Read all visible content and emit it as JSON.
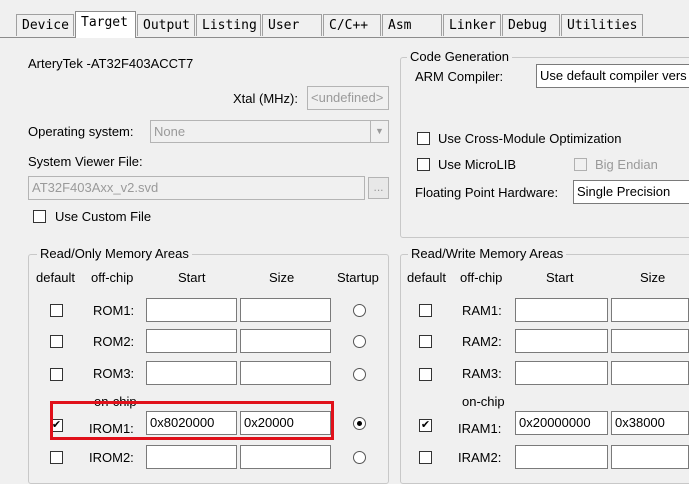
{
  "tabs": [
    "Device",
    "Target",
    "Output",
    "Listing",
    "User",
    "C/C++",
    "Asm",
    "Linker",
    "Debug",
    "Utilities"
  ],
  "device_name": "ArteryTek -AT32F403ACCT7",
  "xtal": {
    "label": "Xtal (MHz):",
    "value": "<undefined>"
  },
  "os": {
    "label": "Operating system:",
    "value": "None"
  },
  "sysview": {
    "label": "System Viewer File:",
    "value": "AT32F403Axx_v2.svd",
    "browse": "..."
  },
  "custom_file": {
    "label": "Use Custom File",
    "checked": false
  },
  "codegen": {
    "title": "Code Generation",
    "compiler_label": "ARM Compiler:",
    "compiler_value": "Use default compiler vers",
    "cross_module": "Use Cross-Module Optimization",
    "microlib": "Use MicroLIB",
    "big_endian": "Big Endian",
    "fp_label": "Floating Point Hardware:",
    "fp_value": "Single Precision"
  },
  "rom": {
    "title": "Read/Only Memory Areas",
    "headers": {
      "default": "default",
      "offchip": "off-chip",
      "start": "Start",
      "size": "Size",
      "startup": "Startup"
    },
    "onchip": "on-chip",
    "rows": [
      {
        "label": "ROM1:",
        "start": "",
        "size": "",
        "checked": false,
        "startup": false
      },
      {
        "label": "ROM2:",
        "start": "",
        "size": "",
        "checked": false,
        "startup": false
      },
      {
        "label": "ROM3:",
        "start": "",
        "size": "",
        "checked": false,
        "startup": false
      },
      {
        "label": "IROM1:",
        "start": "0x8020000",
        "size": "0x20000",
        "checked": true,
        "startup": true
      },
      {
        "label": "IROM2:",
        "start": "",
        "size": "",
        "checked": false,
        "startup": false
      }
    ]
  },
  "ram": {
    "title": "Read/Write Memory Areas",
    "headers": {
      "default": "default",
      "offchip": "off-chip",
      "start": "Start",
      "size": "Size"
    },
    "onchip": "on-chip",
    "rows": [
      {
        "label": "RAM1:",
        "start": "",
        "size": "",
        "checked": false
      },
      {
        "label": "RAM2:",
        "start": "",
        "size": "",
        "checked": false
      },
      {
        "label": "RAM3:",
        "start": "",
        "size": "",
        "checked": false
      },
      {
        "label": "IRAM1:",
        "start": "0x20000000",
        "size": "0x38000",
        "checked": true
      },
      {
        "label": "IRAM2:",
        "start": "",
        "size": "",
        "checked": false
      }
    ]
  },
  "highlight_color": "#e0101a"
}
